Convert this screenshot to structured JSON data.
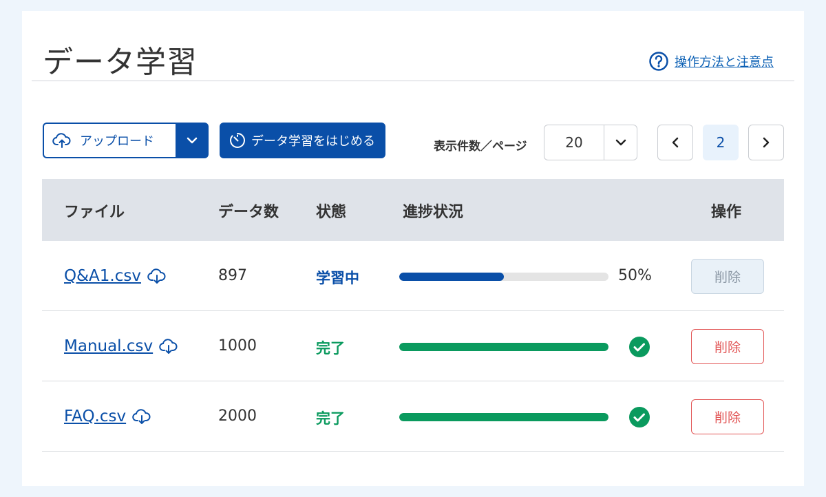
{
  "page": {
    "title": "データ学習",
    "help_link": "操作方法と注意点"
  },
  "toolbar": {
    "upload_label": "アップロード",
    "start_label": "データ学習をはじめる",
    "per_page_label": "表示件数／ページ",
    "per_page_value": "20",
    "current_page": "2"
  },
  "table": {
    "headers": {
      "file": "ファイル",
      "count": "データ数",
      "status": "状態",
      "progress": "進捗状況",
      "action": "操作"
    },
    "rows": [
      {
        "file": "Q&A1.csv",
        "count": "897",
        "status": "学習中",
        "progress_percent": 50,
        "progress_label": "50%",
        "delete_label": "削除",
        "delete_enabled": false
      },
      {
        "file": "Manual.csv",
        "count": "1000",
        "status": "完了",
        "progress_percent": 100,
        "delete_label": "削除",
        "delete_enabled": true
      },
      {
        "file": "FAQ.csv",
        "count": "2000",
        "status": "完了",
        "progress_percent": 100,
        "delete_label": "削除",
        "delete_enabled": true
      }
    ]
  },
  "colors": {
    "primary": "#0a4fa8",
    "success": "#0a9a5e",
    "danger": "#e25656",
    "header_bg": "#dfe3e9",
    "page_bg": "#eef5fc"
  }
}
